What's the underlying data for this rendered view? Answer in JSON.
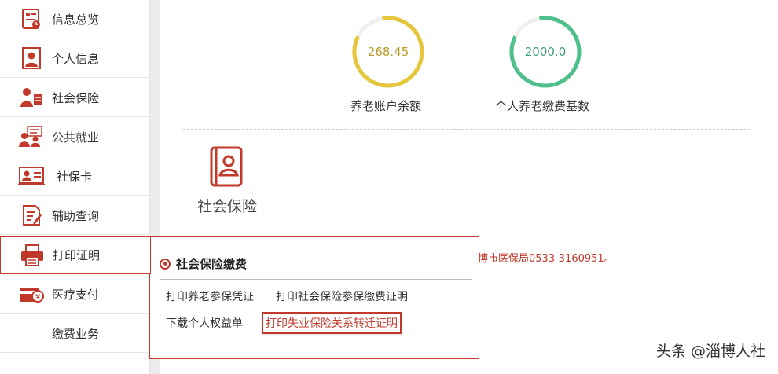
{
  "sidebar": {
    "items": [
      {
        "label": "信息总览",
        "icon": "overview-icon"
      },
      {
        "label": "个人信息",
        "icon": "person-card-icon"
      },
      {
        "label": "社会保险",
        "icon": "people-insurance-icon"
      },
      {
        "label": "公共就业",
        "icon": "employment-icon"
      },
      {
        "label": "社保卡",
        "icon": "id-card-icon"
      },
      {
        "label": "辅助查询",
        "icon": "query-doc-icon"
      },
      {
        "label": "打印证明",
        "icon": "printer-icon"
      },
      {
        "label": "医疗支付",
        "icon": "medical-payment-icon"
      },
      {
        "label": "缴费业务",
        "icon": ""
      }
    ],
    "active_index": 6
  },
  "stats": {
    "pension_balance": {
      "value": "268.45",
      "label": "养老账户余额",
      "color": "#e6c63a"
    },
    "pension_base": {
      "value": "2000.0",
      "label": "个人养老缴费基数",
      "color": "#4fbf8c"
    }
  },
  "section": {
    "title": "社会保险",
    "icon": "social-insurance-book-icon"
  },
  "notice": {
    "text": "博市医保局0533-3160951。"
  },
  "popup": {
    "title": "社会保险缴费",
    "links": {
      "pension_voucher": "打印养老参保凭证",
      "payment_certificate": "打印社会保险参保缴费证明",
      "rights_statement": "下载个人权益单",
      "unemployment_transfer": "打印失业保险关系转迁证明"
    }
  },
  "watermark": "头条 @淄博人社",
  "colors": {
    "accent": "#c0392b",
    "gauge_yellow": "#e6c63a",
    "gauge_green": "#4fbf8c"
  }
}
